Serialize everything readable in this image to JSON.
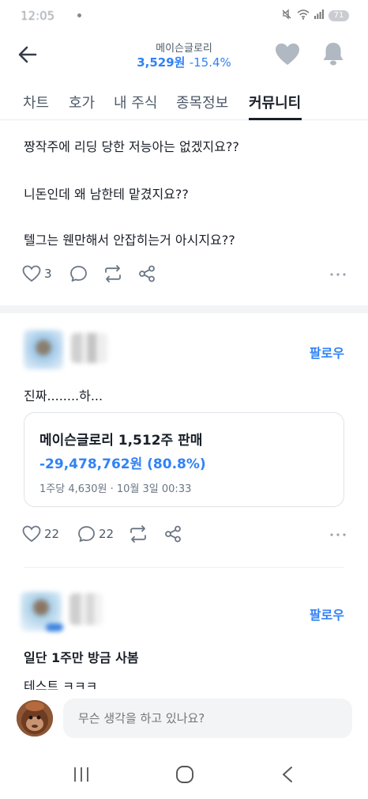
{
  "status": {
    "time": "12:05"
  },
  "battery": "71",
  "header": {
    "stock_name": "메이슨글로리",
    "price": "3,529원",
    "change": "-15.4%"
  },
  "tabs": [
    "차트",
    "호가",
    "내 주식",
    "종목정보",
    "커뮤니티"
  ],
  "active_tab": "커뮤니티",
  "post1": {
    "lines": [
      "짱작주에 리딩 당한 저능아는 없겠지요??",
      "니돈인데 왜 남한테 맡겼지요??",
      "텔그는 웬만해서 안잡히는거 아시지요??"
    ],
    "likes": "3"
  },
  "post2": {
    "follow_label": "팔로우",
    "text": "진짜........하...",
    "trade": {
      "title": "메이슨글로리 1,512주 판매",
      "profit": "-29,478,762원 (80.8%)",
      "meta": "1주당 4,630원 · 10월 3일 00:33"
    },
    "likes": "22",
    "comments": "22"
  },
  "post3": {
    "follow_label": "팔로우",
    "title": "일단 1주만 방금 사봄",
    "text": "테스트 ㅋㅋㅋ"
  },
  "composer": {
    "placeholder": "무슨 생각을 하고 있나요?"
  },
  "colors": {
    "accent": "#3182f6",
    "text": "#191f28",
    "divider": "#f2f4f6"
  }
}
